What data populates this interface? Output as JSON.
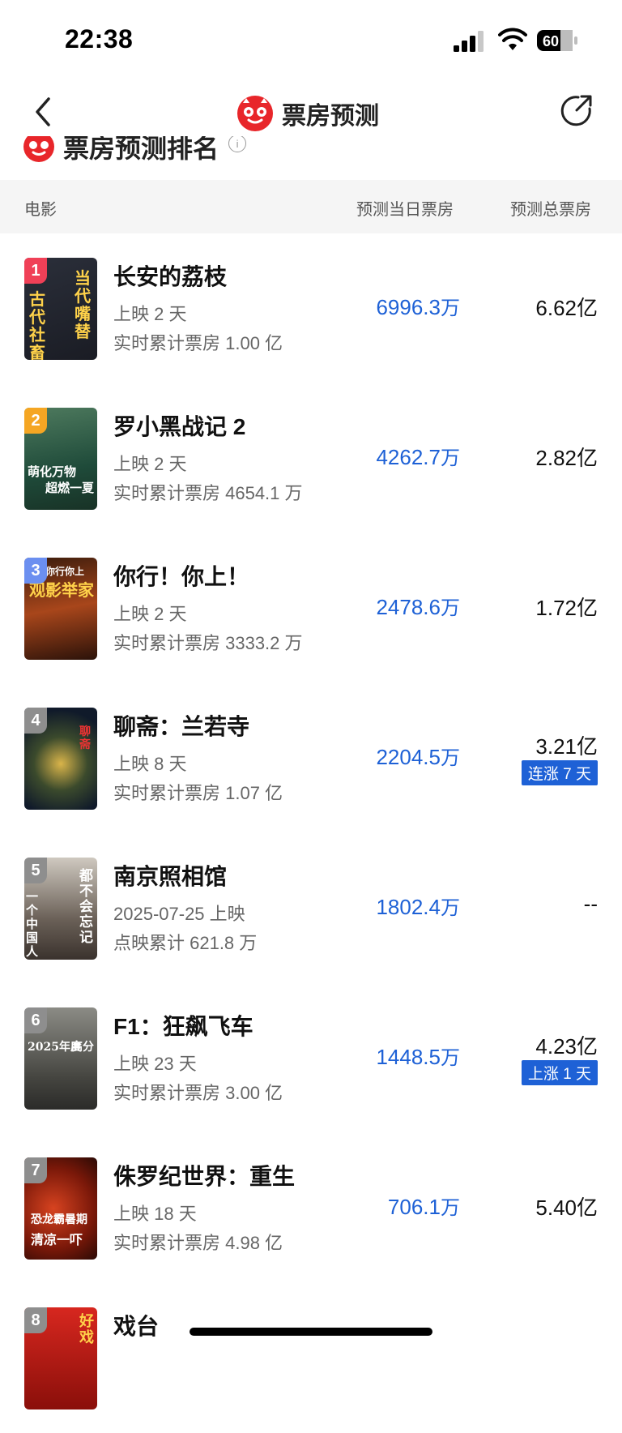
{
  "status_bar": {
    "time": "22:38",
    "battery": "60"
  },
  "nav": {
    "title": "票房预测"
  },
  "section": {
    "title": "票房预测排名",
    "info": "i"
  },
  "table_header": {
    "movie": "电影",
    "day_forecast": "预测当日票房",
    "total_forecast": "预测总票房"
  },
  "colors": {
    "accent_blue": "#1e61d6",
    "brand_red": "#e8262a",
    "rank1": "#f04057",
    "rank2": "#f5a623",
    "rank3": "#6b8ff0",
    "rank_other": "#8e8e8e"
  },
  "movies": [
    {
      "rank": "1",
      "name": "长安的荔枝",
      "sub1": "上映 2 天",
      "sub2": "实时累计票房 1.00 亿",
      "day_value": "6996.3",
      "day_unit": "万",
      "total": "6.62亿",
      "badge": "",
      "poster_text_a": "当代嘴替",
      "poster_text_b": "古代社畜"
    },
    {
      "rank": "2",
      "name": "罗小黑战记 2",
      "sub1": "上映 2 天",
      "sub2": "实时累计票房 4654.1 万",
      "day_value": "4262.7",
      "day_unit": "万",
      "total": "2.82亿",
      "badge": "",
      "poster_text_a": "萌化万物",
      "poster_text_b": "超燃一夏"
    },
    {
      "rank": "3",
      "name": "你行！你上！",
      "sub1": "上映 2 天",
      "sub2": "实时累计票房 3333.2 万",
      "day_value": "2478.6",
      "day_unit": "万",
      "total": "1.72亿",
      "badge": "",
      "poster_text_a": "你行你上",
      "poster_text_b": "观影举家"
    },
    {
      "rank": "4",
      "name": "聊斋：兰若寺",
      "sub1": "上映 8 天",
      "sub2": "实时累计票房 1.07 亿",
      "day_value": "2204.5",
      "day_unit": "万",
      "total": "3.21亿",
      "badge": "连涨 7 天",
      "poster_text_a": "聊斋",
      "poster_text_b": ""
    },
    {
      "rank": "5",
      "name": "南京照相馆",
      "sub1": "2025-07-25 上映",
      "sub2": "点映累计 621.8 万",
      "day_value": "1802.4",
      "day_unit": "万",
      "total": "--",
      "badge": "",
      "poster_text_a": "都不会忘记",
      "poster_text_b": "一个中国人"
    },
    {
      "rank": "6",
      "name": "F1：狂飙飞车",
      "sub1": "上映 23 天",
      "sub2": "实时累计票房 3.00 亿",
      "day_value": "1448.5",
      "day_unit": "万",
      "total": "4.23亿",
      "badge": "上涨 1 天",
      "poster_text_a": "2025年度",
      "poster_text_b": "高分"
    },
    {
      "rank": "7",
      "name": "侏罗纪世界：重生",
      "sub1": "上映 18 天",
      "sub2": "实时累计票房 4.98 亿",
      "day_value": "706.1",
      "day_unit": "万",
      "total": "5.40亿",
      "badge": "",
      "poster_text_a": "恐龙霸暑期",
      "poster_text_b": "清凉一吓"
    },
    {
      "rank": "8",
      "name": "戏台",
      "sub1": "",
      "sub2": "",
      "day_value": "",
      "day_unit": "",
      "total": "",
      "badge": "",
      "poster_text_a": "好戏",
      "poster_text_b": ""
    }
  ]
}
